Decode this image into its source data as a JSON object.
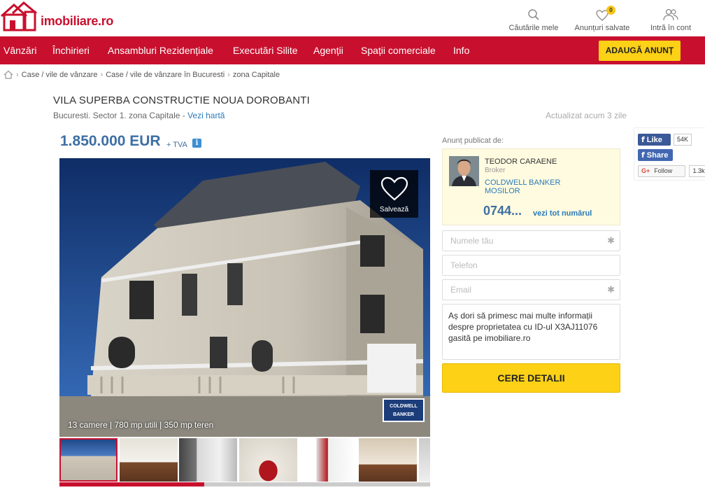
{
  "header": {
    "logo_text": "imobiliare.ro",
    "actions": [
      {
        "label": "Căutările mele",
        "icon": "search-icon"
      },
      {
        "label": "Anunțuri salvate",
        "icon": "heart-icon",
        "badge": "0"
      },
      {
        "label": "Intră în cont",
        "icon": "users-icon"
      }
    ]
  },
  "nav": {
    "items": [
      "Vânzări",
      "Închirieri",
      "Ansambluri Rezidențiale",
      "Executări Silite",
      "Agenții",
      "Spații comerciale",
      "Info"
    ],
    "add_button": "ADAUGĂ ANUNȚ"
  },
  "breadcrumb": [
    "Case / vile de vânzare",
    "Case / vile de vânzare în Bucuresti",
    "zona Capitale"
  ],
  "listing": {
    "title": "VILA SUPERBA CONSTRUCTIE NOUA DOROBANTI",
    "location": "Bucuresti. Sector 1. zona Capitale - ",
    "map_link": "Vezi hartă",
    "updated": "Actualizat acum 3 zile",
    "price": "1.850.000 EUR",
    "vat": "+ TVA",
    "info_icon": "i",
    "save_label": "Salvează",
    "caption": "13 camere | 780 mp utili | 350 mp teren",
    "watermark": "COLDWELL BANKER",
    "photo_progress": 0.39
  },
  "agent": {
    "published_label": "Anunț publicat de:",
    "name": "TEODOR CARAENE",
    "role": "Broker",
    "agency": "COLDWELL BANKER MOSILOR",
    "phone": "0744...",
    "phone_link": "vezi tot numărul"
  },
  "form": {
    "name_placeholder": "Numele tău",
    "phone_placeholder": "Telefon",
    "email_placeholder": "Email",
    "message": "Aș dori să primesc mai multe informații despre proprietatea cu ID-ul X3AJ11076 gasită pe imobiliare.ro",
    "submit": "CERE DETALII"
  },
  "social": {
    "fb_like": "Like",
    "fb_like_count": "54K",
    "fb_share": "Share",
    "g_follow": "Follow",
    "g_count": "1.3k"
  },
  "colors": {
    "brand_red": "#c8102e",
    "accent_yellow": "#fcd116",
    "price_blue": "#3d6fa3"
  }
}
